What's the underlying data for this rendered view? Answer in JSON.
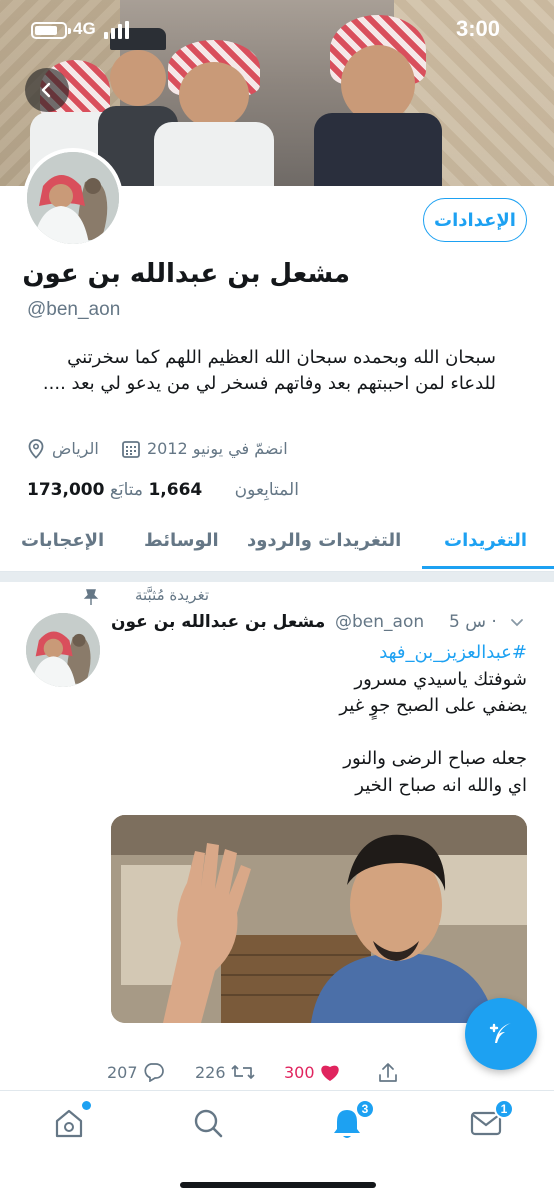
{
  "status_bar": {
    "network": "4G",
    "time": "3:00",
    "battery_level": 0.8
  },
  "profile": {
    "edit_button": "الإعدادات",
    "name": "مشعل بن عبدالله بن عون",
    "handle": "@ben_aon",
    "bio": "سبحان الله وبحمده سبحان الله العظيم اللهم كما سخرتني للدعاء لمن احببتهم بعد وفاتهم فسخر لي من يدعو لي بعد ....",
    "location": "الرياض",
    "joined": "انضمّ في يونيو 2012",
    "following_count": "1,664",
    "following_label": "متابَع",
    "followers_count": "173,000",
    "followers_label": "المتابِعون"
  },
  "tabs": [
    "التغريدات",
    "التغريدات والردود",
    "الوسائط",
    "الإعجابات"
  ],
  "active_tab": 0,
  "tweet": {
    "pinned_label": "تغريدة مُثبَّتة",
    "author_name": "مشعل بن عبدالله بن عون",
    "author_handle": "@ben_aon",
    "time": "5 س ·",
    "hashtag": "#عبدالعزيز_بن_فهد",
    "lines": [
      "شوفتك ياسيدي مسرور",
      "يضفي على الصبح جوٍ غير",
      "",
      "جعله صباح الرضى والنور",
      "اي والله انه صباح الخير"
    ],
    "replies": "207",
    "retweets": "226",
    "likes": "300"
  },
  "nav": {
    "notifications_badge": "3",
    "messages_badge": "1"
  },
  "colors": {
    "accent": "#1da1f2",
    "like": "#e0245e",
    "secondary_text": "#657786"
  },
  "icons": [
    "back-arrow-icon",
    "location-pin-icon",
    "calendar-icon",
    "pin-icon",
    "chevron-down-icon",
    "reply-icon",
    "retweet-icon",
    "heart-icon",
    "share-icon",
    "compose-tweet-icon",
    "home-icon",
    "search-icon",
    "bell-icon",
    "mail-icon"
  ]
}
